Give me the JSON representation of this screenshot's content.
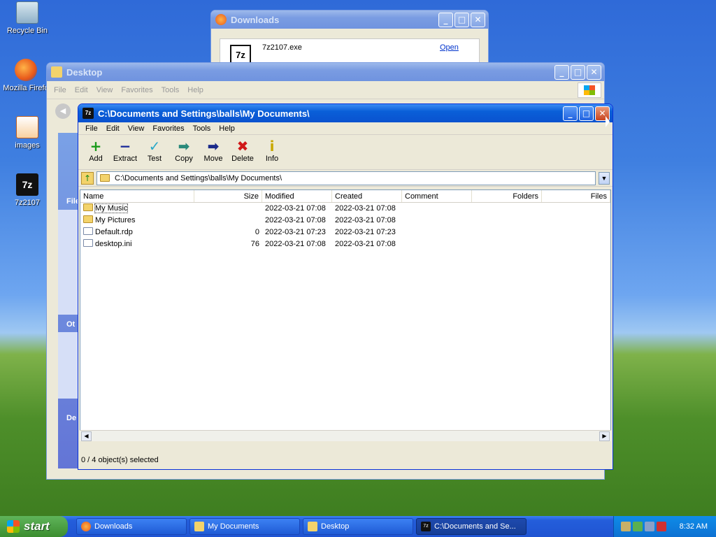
{
  "desktop_icons": [
    {
      "label": "Recycle Bin",
      "icon": "recycle-bin-icon"
    },
    {
      "label": "Mozilla Firefo",
      "icon": "firefox-icon"
    },
    {
      "label": "images",
      "icon": "image-icon"
    },
    {
      "label": "7z2107",
      "icon": "7zip-icon"
    }
  ],
  "downloads_window": {
    "title": "Downloads",
    "item_name": "7z2107.exe",
    "open_label": "Open"
  },
  "desktop_window": {
    "title": "Desktop",
    "menu": [
      "File",
      "Edit",
      "View",
      "Favorites",
      "Tools",
      "Help"
    ],
    "left_panel_headers": [
      "File",
      "Ot",
      "De"
    ]
  },
  "sevenzip_window": {
    "title": "C:\\Documents and Settings\\balls\\My Documents\\",
    "menu": [
      "File",
      "Edit",
      "View",
      "Favorites",
      "Tools",
      "Help"
    ],
    "toolbar": [
      {
        "label": "Add",
        "icon": "add-icon",
        "glyph": "+",
        "color": "#1a9a1a"
      },
      {
        "label": "Extract",
        "icon": "extract-icon",
        "glyph": "−",
        "color": "#1a2a9a"
      },
      {
        "label": "Test",
        "icon": "test-icon",
        "glyph": "✓",
        "color": "#2aa8c8"
      },
      {
        "label": "Copy",
        "icon": "copy-icon",
        "glyph": "➡",
        "color": "#2a8a7a"
      },
      {
        "label": "Move",
        "icon": "move-icon",
        "glyph": "➡",
        "color": "#1a2a8a"
      },
      {
        "label": "Delete",
        "icon": "delete-icon",
        "glyph": "✖",
        "color": "#d01818"
      },
      {
        "label": "Info",
        "icon": "info-icon",
        "glyph": "i",
        "color": "#c8a800"
      }
    ],
    "address": "C:\\Documents and Settings\\balls\\My Documents\\",
    "columns": [
      "Name",
      "Size",
      "Modified",
      "Created",
      "Comment",
      "Folders",
      "Files"
    ],
    "rows": [
      {
        "name": "My Music",
        "type": "folder",
        "size": "",
        "modified": "2022-03-21 07:08",
        "created": "2022-03-21 07:08"
      },
      {
        "name": "My Pictures",
        "type": "folder",
        "size": "",
        "modified": "2022-03-21 07:08",
        "created": "2022-03-21 07:08"
      },
      {
        "name": "Default.rdp",
        "type": "file",
        "size": "0",
        "modified": "2022-03-21 07:23",
        "created": "2022-03-21 07:23"
      },
      {
        "name": "desktop.ini",
        "type": "file",
        "size": "76",
        "modified": "2022-03-21 07:08",
        "created": "2022-03-21 07:08"
      }
    ],
    "status": "0 / 4 object(s) selected"
  },
  "taskbar": {
    "start_label": "start",
    "tasks": [
      {
        "label": "Downloads",
        "icon": "firefox-icon",
        "active": false
      },
      {
        "label": "My Documents",
        "icon": "my-documents-icon",
        "active": false
      },
      {
        "label": "Desktop",
        "icon": "folder-icon",
        "active": false
      },
      {
        "label": "C:\\Documents and Se...",
        "icon": "7zip-icon",
        "active": true
      }
    ],
    "clock": "8:32 AM"
  }
}
